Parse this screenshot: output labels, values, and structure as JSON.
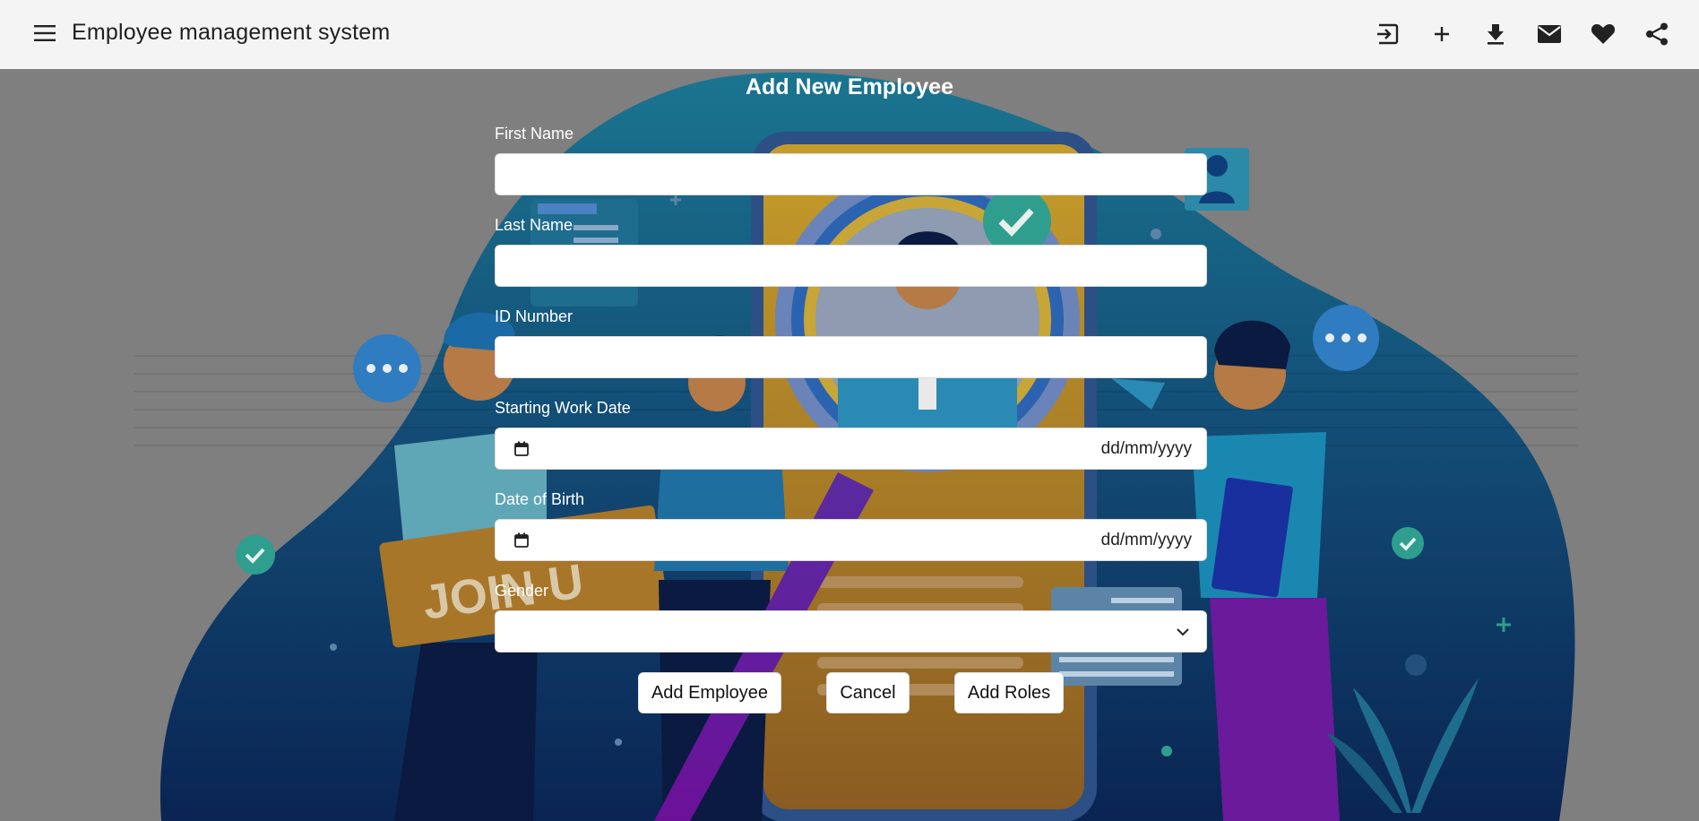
{
  "app": {
    "title": "Employee management system"
  },
  "toolbar": {
    "icons": [
      "menu-icon",
      "login-icon",
      "add-icon",
      "download-icon",
      "mail-icon",
      "heart-icon",
      "share-icon"
    ]
  },
  "form": {
    "title": "Add New Employee",
    "first_name_label": "First Name",
    "first_name_value": "",
    "last_name_label": "Last Name",
    "last_name_value": "",
    "id_number_label": "ID Number",
    "id_number_value": "",
    "start_date_label": "Starting Work Date",
    "start_date_placeholder": "dd/mm/yyyy",
    "dob_label": "Date of Birth",
    "dob_placeholder": "dd/mm/yyyy",
    "gender_label": "Gender",
    "gender_value": ""
  },
  "buttons": {
    "add_employee": "Add Employee",
    "cancel": "Cancel",
    "add_roles": "Add Roles"
  },
  "illustration": {
    "sign_text": "JOIN U"
  },
  "colors": {
    "toolbar_bg": "#f4f4f4",
    "page_overlay": "#808080",
    "blob_top": "#1f7f96",
    "blob_bottom": "#0b2a5e",
    "phone": "#c08a2a",
    "accent_purple": "#5a1a8a"
  }
}
